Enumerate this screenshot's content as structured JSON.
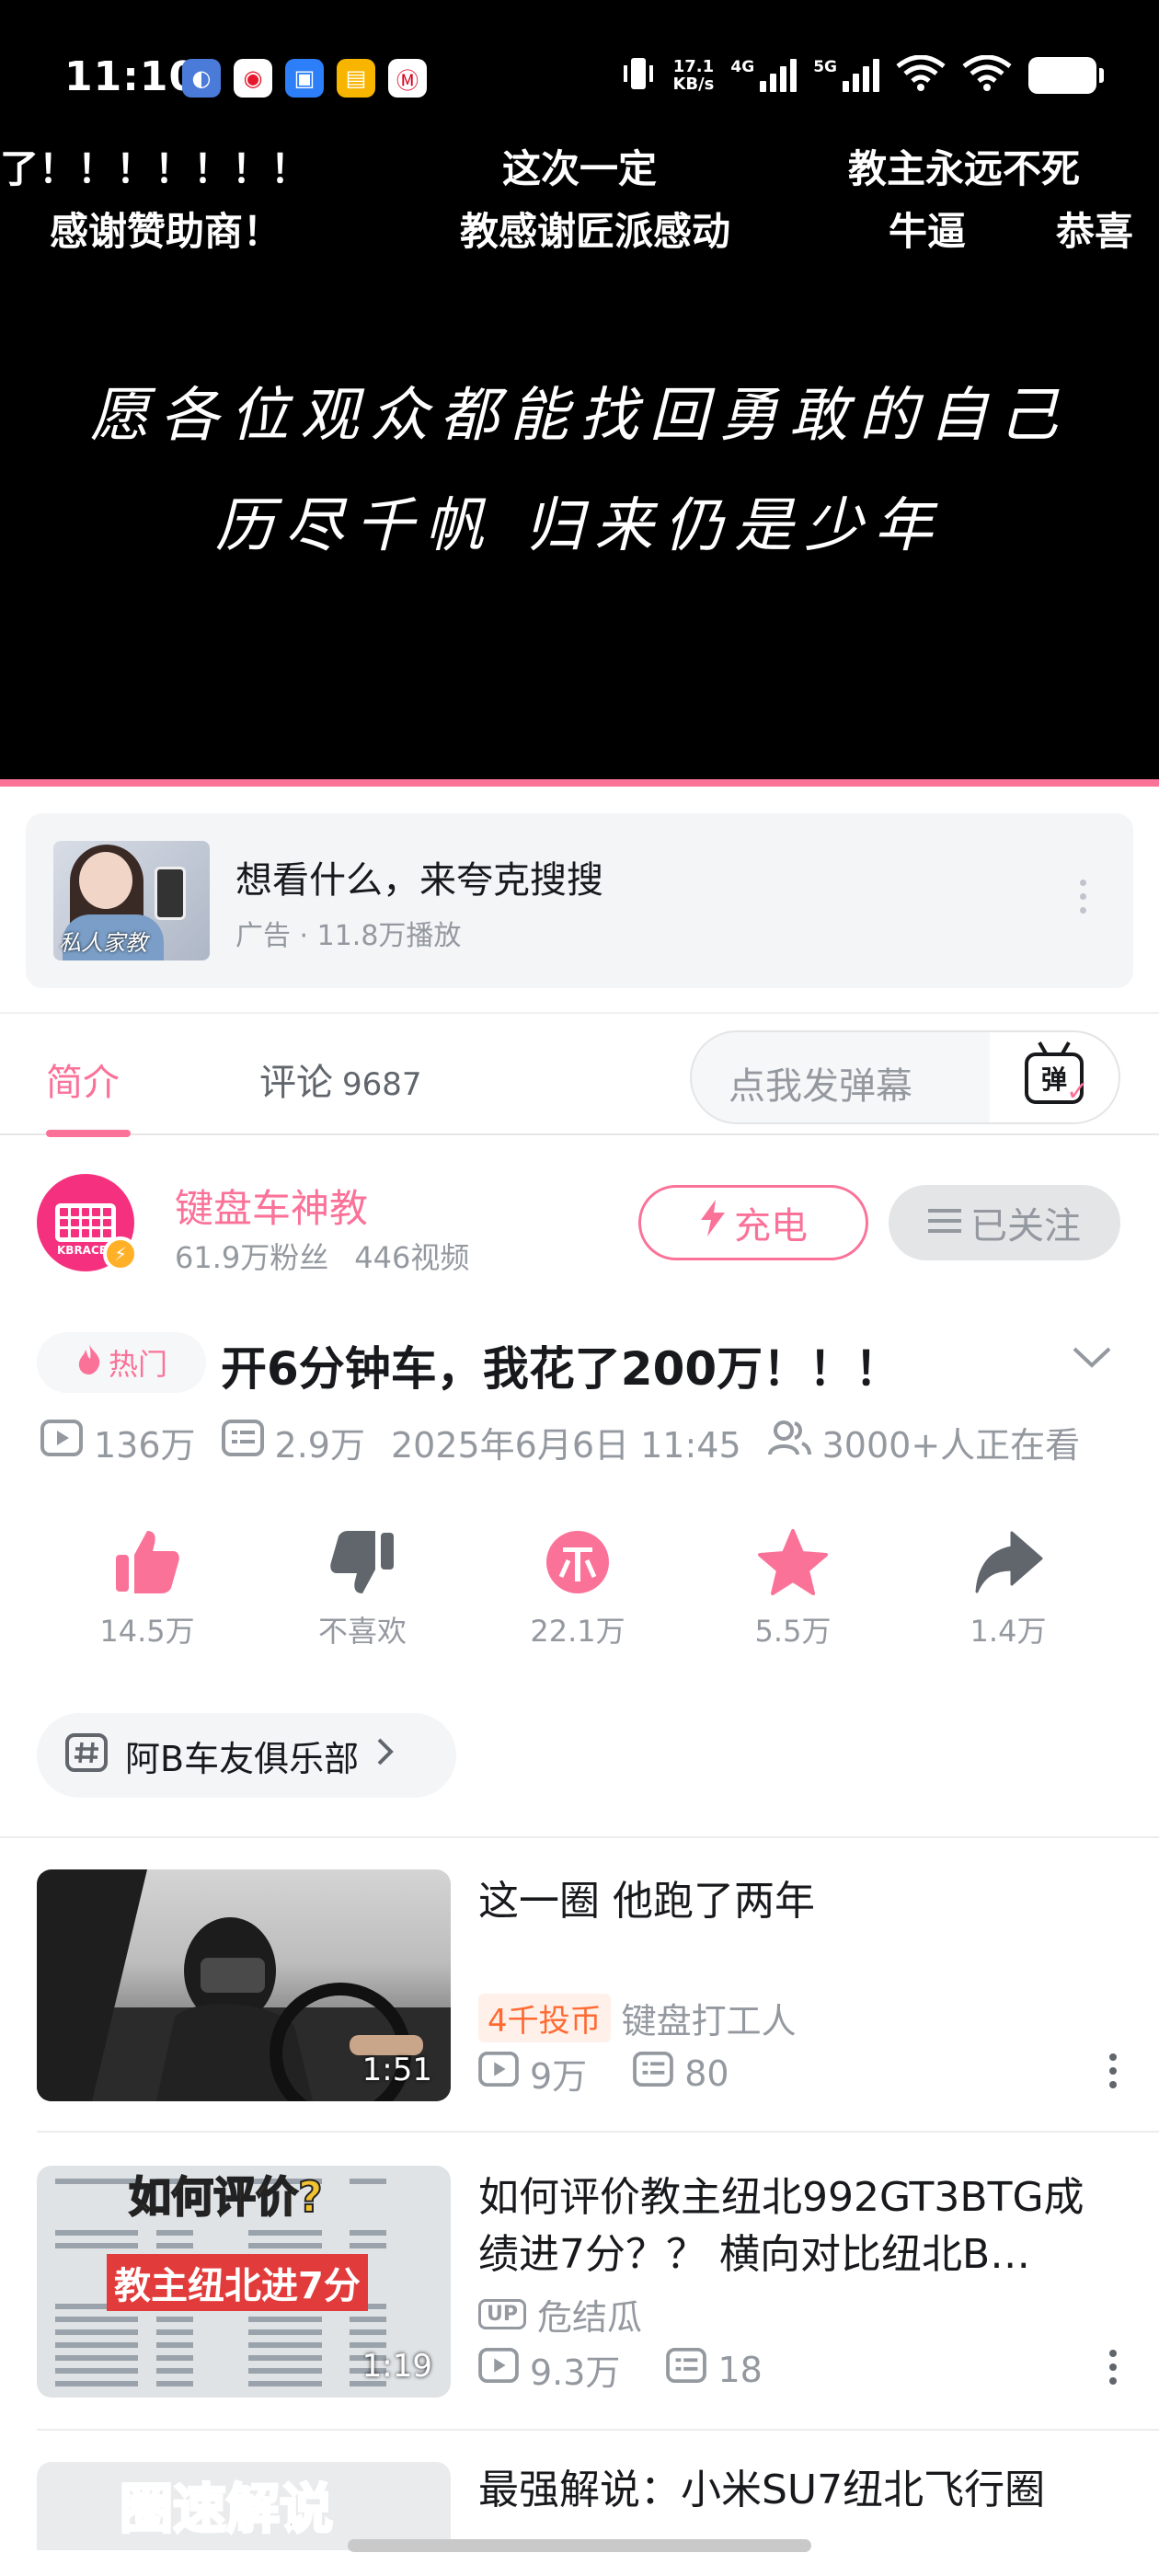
{
  "status_bar": {
    "time": "11:10",
    "net_speed_value": "17.1",
    "net_speed_unit": "KB/s",
    "sig1_label": "4G",
    "sig2_label": "5G",
    "app_icons": [
      "planet-app-icon",
      "weibo-icon",
      "browser-icon",
      "wallet-icon",
      "metro-icon"
    ]
  },
  "player": {
    "danmaku": [
      "了！！！！！！！",
      "这次一定",
      "教主永远不死",
      "感谢赞助商！",
      "教感谢匠派感动",
      "牛逼",
      "恭喜"
    ],
    "subtitle_line1": "愿各位观众都能找回勇敢的自己",
    "subtitle_line2": "历尽千帆 归来仍是少年"
  },
  "ad": {
    "thumb_caption": "私人家教",
    "title": "想看什么，来夸克搜搜",
    "meta": "广告 · 11.8万播放"
  },
  "tabs": {
    "intro": "简介",
    "comments": "评论",
    "comments_count": "9687",
    "danmaku_placeholder": "点我发弹幕",
    "danmaku_icon_glyph": "弹"
  },
  "uploader": {
    "name": "键盘车神教",
    "avatar_text": "KBRACE",
    "fans": "61.9万粉丝",
    "videos": "446视频",
    "charge_label": "充电",
    "follow_label": "已关注"
  },
  "video": {
    "hot_label": "热门",
    "title": "开6分钟车，我花了200万！！！",
    "views": "136万",
    "danmaku_count": "2.9万",
    "date": "2025年6月6日 11:45",
    "watching": "3000+人正在看"
  },
  "actions": {
    "like": "14.5万",
    "dislike": "不喜欢",
    "coin": "22.1万",
    "favorite": "5.5万",
    "share": "1.4万"
  },
  "club": {
    "label": "阿B车友俱乐部"
  },
  "related": [
    {
      "title": "这一圈 他跑了两年",
      "badge": "4千投币",
      "author": "键盘打工人",
      "views": "9万",
      "danmaku": "80",
      "duration": "1:51"
    },
    {
      "title": "如何评价教主纽北992GT3BTG成绩进7分？？ 横向对比纽北B…",
      "up_tag": "UP",
      "author": "危结瓜",
      "views": "9.3万",
      "danmaku": "18",
      "duration": "1:19",
      "thumb_text1": "如何评价?",
      "thumb_text2": "教主纽北进7分"
    },
    {
      "title": "最强解说：小米SU7纽北飞行圈",
      "thumb_text": "圈速解说"
    }
  ],
  "colors": {
    "accent": "#fb7299",
    "coin_orange": "#ff6a33",
    "text_primary": "#18191c",
    "text_secondary": "#9499a0"
  }
}
